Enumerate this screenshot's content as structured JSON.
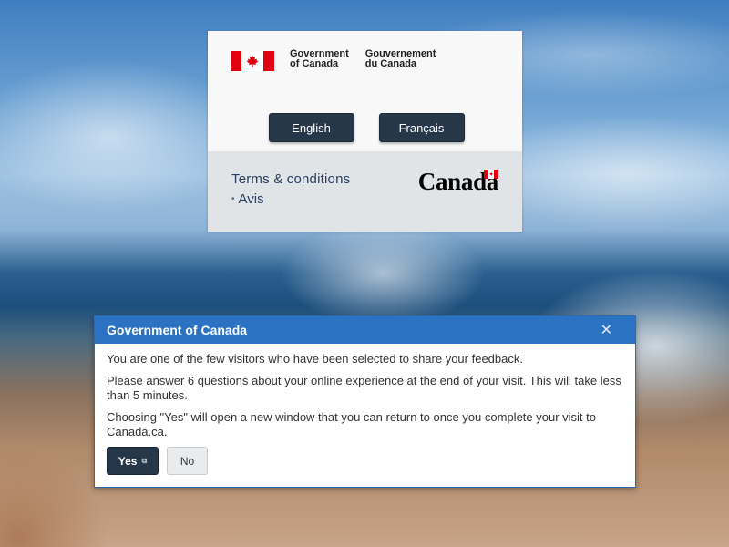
{
  "signature": {
    "en_line1": "Government",
    "en_line2": "of Canada",
    "fr_line1": "Gouvernement",
    "fr_line2": "du Canada"
  },
  "language_buttons": {
    "english": "English",
    "french": "Français"
  },
  "footer": {
    "terms": "Terms & conditions",
    "avis": "Avis",
    "wordmark": "Canadä"
  },
  "modal": {
    "title": "Government of Canada",
    "close_glyph": "✕",
    "paragraph1": "You are one of the few visitors who have been selected to share your feedback.",
    "paragraph2": "Please answer 6 questions about your online experience at the end of your visit. This will take less than 5 minutes.",
    "paragraph3": "Choosing \"Yes\" will open a new window that you can return to once you complete your visit to Canada.ca.",
    "yes_label": "Yes",
    "no_label": "No"
  },
  "colors": {
    "flag_red": "#e1000f",
    "button_navy": "#26374a",
    "modal_header_blue": "#2b72c2",
    "link_blue": "#284162"
  }
}
